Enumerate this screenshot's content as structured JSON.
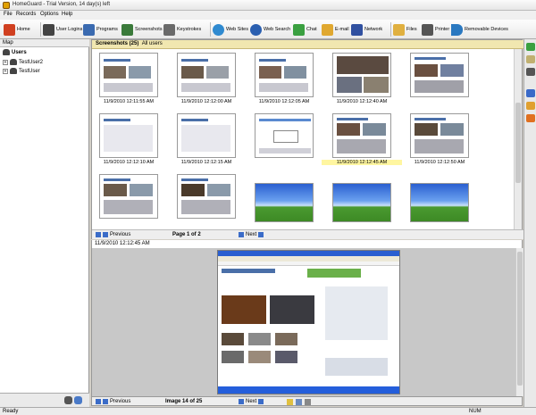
{
  "window": {
    "title": "HomeGuard - Trial Version, 14 day(s) left"
  },
  "menu": [
    {
      "label": "File",
      "x": 4
    },
    {
      "label": "Records",
      "x": 18
    },
    {
      "label": "Options",
      "x": 45
    },
    {
      "label": "Help",
      "x": 69
    }
  ],
  "toolbar": {
    "items": [
      {
        "label": "Home",
        "name": "home",
        "color": "#d04020"
      },
      {
        "label": "User Logins",
        "name": "user-logins",
        "color": "#444444"
      },
      {
        "label": "Programs",
        "name": "programs",
        "color": "#3a6ab0"
      },
      {
        "label": "Screenshots",
        "name": "screenshots",
        "color": "#3a7a3a"
      },
      {
        "label": "Keystrokes",
        "name": "keystrokes",
        "color": "#6a6a6a"
      },
      {
        "label": "Web Sites",
        "name": "web-sites",
        "color": "#2f8ad0"
      },
      {
        "label": "Web Search",
        "name": "web-search",
        "color": "#2a5fb0"
      },
      {
        "label": "Chat",
        "name": "chat",
        "color": "#3aa040"
      },
      {
        "label": "E-mail",
        "name": "email",
        "color": "#e0a830"
      },
      {
        "label": "Network",
        "name": "network",
        "color": "#3050a0"
      },
      {
        "label": "Files",
        "name": "files",
        "color": "#e0b040"
      },
      {
        "label": "Printer",
        "name": "printer",
        "color": "#555555"
      },
      {
        "label": "Removable Devices",
        "name": "removable-devices",
        "color": "#2a78c0"
      }
    ]
  },
  "map": {
    "header": "Map",
    "root": "Users",
    "users": [
      "TestUser2",
      "TestUser"
    ]
  },
  "screenshots": {
    "header": "Screenshots (25)",
    "filter": "All users",
    "captions": [
      "11/9/2010 12:11:55 AM",
      "11/9/2010 12:12:00 AM",
      "11/9/2010 12:12:05 AM",
      "11/9/2010 12:12:40 AM",
      "11/9/2010 12:12:10 AM",
      "11/9/2010 12:12:15 AM",
      "11/9/2010 12:12:45 AM",
      "11/9/2010 12:12:50 AM"
    ],
    "pager": {
      "previous": "Previous",
      "page": "Page 1 of 2",
      "next": "Next"
    }
  },
  "preview": {
    "timestamp": "11/9/2010 12:12:45 AM",
    "nav": {
      "previous": "Previous",
      "image": "Image 14 of 25",
      "next": "Next"
    }
  },
  "status": {
    "left": "Ready",
    "right": "NUM"
  }
}
